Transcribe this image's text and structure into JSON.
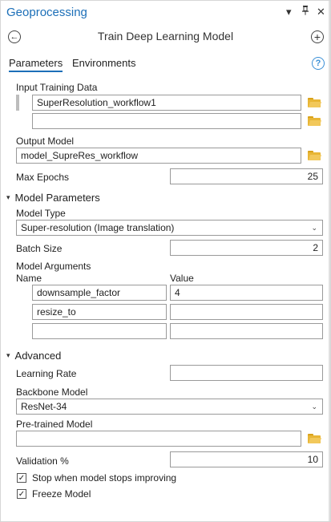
{
  "window": {
    "title": "Geoprocessing",
    "menu_glyph": "▾",
    "pin_glyph": "🖈",
    "close_glyph": "✕"
  },
  "header": {
    "tool_title": "Train Deep Learning Model",
    "back_glyph": "←",
    "add_glyph": "+"
  },
  "tabs": [
    {
      "label": "Parameters",
      "active": true
    },
    {
      "label": "Environments",
      "active": false
    }
  ],
  "help_glyph": "?",
  "params": {
    "input_training_data": {
      "label": "Input Training Data",
      "rows": [
        "SuperResolution_workflow1",
        ""
      ]
    },
    "output_model": {
      "label": "Output Model",
      "value": "model_SupreRes_workflow"
    },
    "max_epochs": {
      "label": "Max Epochs",
      "value": "25"
    }
  },
  "model_parameters": {
    "section_label": "Model Parameters",
    "model_type": {
      "label": "Model Type",
      "value": "Super-resolution (Image translation)"
    },
    "batch_size": {
      "label": "Batch Size",
      "value": "2"
    },
    "model_arguments": {
      "label": "Model Arguments",
      "col_name": "Name",
      "col_value": "Value",
      "rows": [
        {
          "name": "downsample_factor",
          "value": "4"
        },
        {
          "name": "resize_to",
          "value": ""
        },
        {
          "name": "",
          "value": ""
        }
      ]
    }
  },
  "advanced": {
    "section_label": "Advanced",
    "learning_rate": {
      "label": "Learning Rate",
      "value": ""
    },
    "backbone_model": {
      "label": "Backbone Model",
      "value": "ResNet-34"
    },
    "pretrained_model": {
      "label": "Pre-trained Model",
      "value": ""
    },
    "validation": {
      "label": "Validation %",
      "value": "10"
    },
    "stop_improving": {
      "label": "Stop when model stops improving",
      "checked": true
    },
    "freeze_model": {
      "label": "Freeze Model",
      "checked": true
    }
  },
  "colors": {
    "accent": "#1c6fb8",
    "folder": "#e8b636"
  },
  "glyphs": {
    "chevron_down": "⌄",
    "section_expanded": "▾",
    "check": "✓"
  }
}
